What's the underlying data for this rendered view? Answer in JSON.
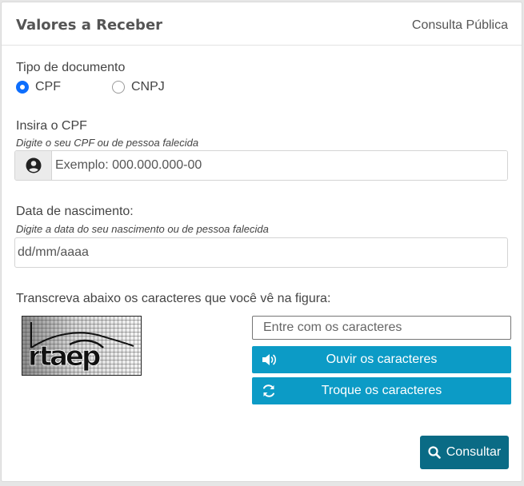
{
  "header": {
    "title": "Valores a Receber",
    "subtitle": "Consulta Pública"
  },
  "document_type": {
    "label": "Tipo de documento",
    "options": [
      {
        "label": "CPF",
        "checked": true
      },
      {
        "label": "CNPJ",
        "checked": false
      }
    ]
  },
  "cpf": {
    "label": "Insira o CPF",
    "hint": "Digite o seu CPF ou de pessoa falecida",
    "placeholder": "Exemplo: 000.000.000-00",
    "icon": "user-circle-icon"
  },
  "birth_date": {
    "label": "Data de nascimento:",
    "hint": "Digite a data do seu nascimento ou de pessoa falecida",
    "placeholder": "dd/mm/aaaa"
  },
  "captcha": {
    "instruction": "Transcreva abaixo os caracteres que você vê na figura:",
    "image_text": "rtaep",
    "input_placeholder": "Entre com os caracteres",
    "listen_label": "Ouvir os caracteres",
    "listen_icon": "speaker-icon",
    "refresh_label": "Troque os caracteres",
    "refresh_icon": "refresh-icon"
  },
  "submit": {
    "label": "Consultar",
    "icon": "search-icon"
  },
  "colors": {
    "primary_radio": "#0d6efd",
    "teal_button": "#0c9bc6",
    "submit_button": "#0a6b85"
  }
}
